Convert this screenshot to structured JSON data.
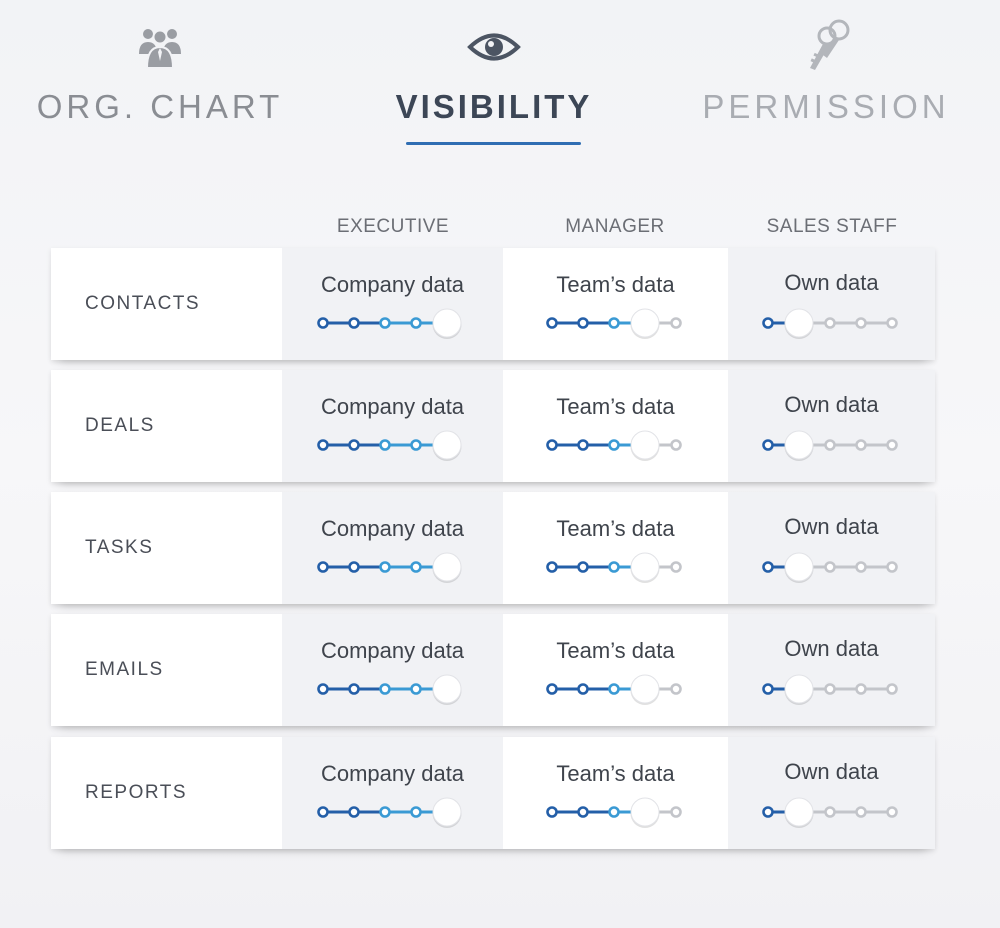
{
  "tabs": {
    "org": {
      "label": "ORG. CHART",
      "icon": "org-chart-people-icon"
    },
    "visibility": {
      "label": "VISIBILITY",
      "icon": "eye-icon",
      "active": true
    },
    "permission": {
      "label": "PERMISSION",
      "icon": "keys-icon"
    }
  },
  "columns": [
    "EXECUTIVE",
    "MANAGER",
    "SALES STAFF"
  ],
  "levels_total": 5,
  "rows": [
    {
      "label": "CONTACTS",
      "cells": [
        {
          "text": "Company data",
          "level": 5
        },
        {
          "text": "Team’s data",
          "level": 4
        },
        {
          "text": "Own data",
          "level": 2
        }
      ]
    },
    {
      "label": "DEALS",
      "cells": [
        {
          "text": "Company data",
          "level": 5
        },
        {
          "text": "Team’s data",
          "level": 4
        },
        {
          "text": "Own data",
          "level": 2
        }
      ]
    },
    {
      "label": "TASKS",
      "cells": [
        {
          "text": "Company data",
          "level": 5
        },
        {
          "text": "Team’s data",
          "level": 4
        },
        {
          "text": "Own data",
          "level": 2
        }
      ]
    },
    {
      "label": "EMAILS",
      "cells": [
        {
          "text": "Company data",
          "level": 5
        },
        {
          "text": "Team’s data",
          "level": 4
        },
        {
          "text": "Own data",
          "level": 2
        }
      ]
    },
    {
      "label": "REPORTS",
      "cells": [
        {
          "text": "Company data",
          "level": 5
        },
        {
          "text": "Team’s data",
          "level": 4
        },
        {
          "text": "Own data",
          "level": 2
        }
      ]
    }
  ],
  "colors": {
    "accent": "#2f6db3",
    "dot_active_dark": "#245fa8",
    "dot_active_light": "#3a9ad4",
    "dot_inactive": "#c3c5ca"
  }
}
